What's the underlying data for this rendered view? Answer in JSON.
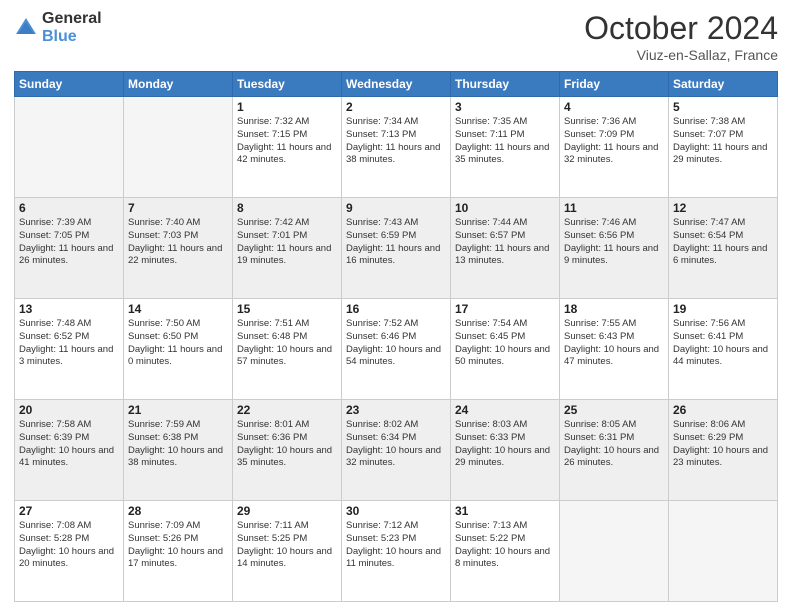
{
  "header": {
    "logo_general": "General",
    "logo_blue": "Blue",
    "month_title": "October 2024",
    "location": "Viuz-en-Sallaz, France"
  },
  "days_of_week": [
    "Sunday",
    "Monday",
    "Tuesday",
    "Wednesday",
    "Thursday",
    "Friday",
    "Saturday"
  ],
  "weeks": [
    [
      {
        "num": "",
        "info": ""
      },
      {
        "num": "",
        "info": ""
      },
      {
        "num": "1",
        "info": "Sunrise: 7:32 AM\nSunset: 7:15 PM\nDaylight: 11 hours and 42 minutes."
      },
      {
        "num": "2",
        "info": "Sunrise: 7:34 AM\nSunset: 7:13 PM\nDaylight: 11 hours and 38 minutes."
      },
      {
        "num": "3",
        "info": "Sunrise: 7:35 AM\nSunset: 7:11 PM\nDaylight: 11 hours and 35 minutes."
      },
      {
        "num": "4",
        "info": "Sunrise: 7:36 AM\nSunset: 7:09 PM\nDaylight: 11 hours and 32 minutes."
      },
      {
        "num": "5",
        "info": "Sunrise: 7:38 AM\nSunset: 7:07 PM\nDaylight: 11 hours and 29 minutes."
      }
    ],
    [
      {
        "num": "6",
        "info": "Sunrise: 7:39 AM\nSunset: 7:05 PM\nDaylight: 11 hours and 26 minutes."
      },
      {
        "num": "7",
        "info": "Sunrise: 7:40 AM\nSunset: 7:03 PM\nDaylight: 11 hours and 22 minutes."
      },
      {
        "num": "8",
        "info": "Sunrise: 7:42 AM\nSunset: 7:01 PM\nDaylight: 11 hours and 19 minutes."
      },
      {
        "num": "9",
        "info": "Sunrise: 7:43 AM\nSunset: 6:59 PM\nDaylight: 11 hours and 16 minutes."
      },
      {
        "num": "10",
        "info": "Sunrise: 7:44 AM\nSunset: 6:57 PM\nDaylight: 11 hours and 13 minutes."
      },
      {
        "num": "11",
        "info": "Sunrise: 7:46 AM\nSunset: 6:56 PM\nDaylight: 11 hours and 9 minutes."
      },
      {
        "num": "12",
        "info": "Sunrise: 7:47 AM\nSunset: 6:54 PM\nDaylight: 11 hours and 6 minutes."
      }
    ],
    [
      {
        "num": "13",
        "info": "Sunrise: 7:48 AM\nSunset: 6:52 PM\nDaylight: 11 hours and 3 minutes."
      },
      {
        "num": "14",
        "info": "Sunrise: 7:50 AM\nSunset: 6:50 PM\nDaylight: 11 hours and 0 minutes."
      },
      {
        "num": "15",
        "info": "Sunrise: 7:51 AM\nSunset: 6:48 PM\nDaylight: 10 hours and 57 minutes."
      },
      {
        "num": "16",
        "info": "Sunrise: 7:52 AM\nSunset: 6:46 PM\nDaylight: 10 hours and 54 minutes."
      },
      {
        "num": "17",
        "info": "Sunrise: 7:54 AM\nSunset: 6:45 PM\nDaylight: 10 hours and 50 minutes."
      },
      {
        "num": "18",
        "info": "Sunrise: 7:55 AM\nSunset: 6:43 PM\nDaylight: 10 hours and 47 minutes."
      },
      {
        "num": "19",
        "info": "Sunrise: 7:56 AM\nSunset: 6:41 PM\nDaylight: 10 hours and 44 minutes."
      }
    ],
    [
      {
        "num": "20",
        "info": "Sunrise: 7:58 AM\nSunset: 6:39 PM\nDaylight: 10 hours and 41 minutes."
      },
      {
        "num": "21",
        "info": "Sunrise: 7:59 AM\nSunset: 6:38 PM\nDaylight: 10 hours and 38 minutes."
      },
      {
        "num": "22",
        "info": "Sunrise: 8:01 AM\nSunset: 6:36 PM\nDaylight: 10 hours and 35 minutes."
      },
      {
        "num": "23",
        "info": "Sunrise: 8:02 AM\nSunset: 6:34 PM\nDaylight: 10 hours and 32 minutes."
      },
      {
        "num": "24",
        "info": "Sunrise: 8:03 AM\nSunset: 6:33 PM\nDaylight: 10 hours and 29 minutes."
      },
      {
        "num": "25",
        "info": "Sunrise: 8:05 AM\nSunset: 6:31 PM\nDaylight: 10 hours and 26 minutes."
      },
      {
        "num": "26",
        "info": "Sunrise: 8:06 AM\nSunset: 6:29 PM\nDaylight: 10 hours and 23 minutes."
      }
    ],
    [
      {
        "num": "27",
        "info": "Sunrise: 7:08 AM\nSunset: 5:28 PM\nDaylight: 10 hours and 20 minutes."
      },
      {
        "num": "28",
        "info": "Sunrise: 7:09 AM\nSunset: 5:26 PM\nDaylight: 10 hours and 17 minutes."
      },
      {
        "num": "29",
        "info": "Sunrise: 7:11 AM\nSunset: 5:25 PM\nDaylight: 10 hours and 14 minutes."
      },
      {
        "num": "30",
        "info": "Sunrise: 7:12 AM\nSunset: 5:23 PM\nDaylight: 10 hours and 11 minutes."
      },
      {
        "num": "31",
        "info": "Sunrise: 7:13 AM\nSunset: 5:22 PM\nDaylight: 10 hours and 8 minutes."
      },
      {
        "num": "",
        "info": ""
      },
      {
        "num": "",
        "info": ""
      }
    ]
  ]
}
